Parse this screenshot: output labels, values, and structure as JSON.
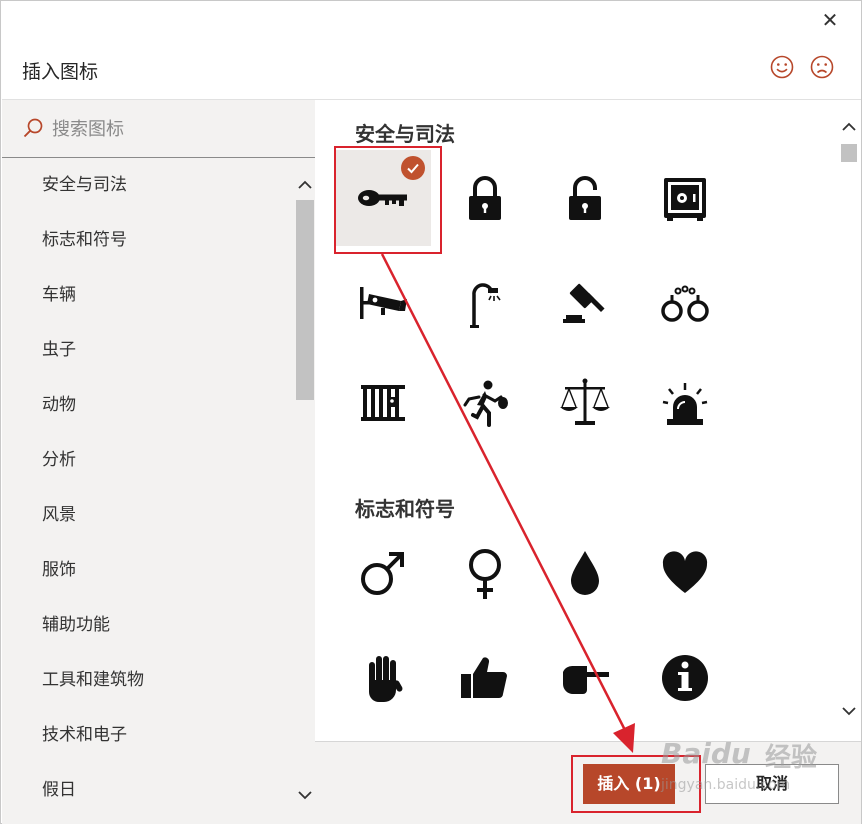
{
  "dialog": {
    "title": "插入图标",
    "close_glyph": "✕"
  },
  "feedback": {
    "happy_icon": "smile-icon",
    "sad_icon": "frown-icon"
  },
  "search": {
    "placeholder": "搜索图标"
  },
  "categories": [
    "安全与司法",
    "标志和符号",
    "车辆",
    "虫子",
    "动物",
    "分析",
    "风景",
    "服饰",
    "辅助功能",
    "工具和建筑物",
    "技术和电子",
    "假日"
  ],
  "sections": [
    {
      "title": "安全与司法",
      "icons": [
        "key-icon",
        "lock-icon",
        "unlock-icon",
        "safe-icon",
        "security-camera-icon",
        "street-light-icon",
        "gavel-icon",
        "handcuffs-icon",
        "jail-icon",
        "thief-icon",
        "scales-of-justice-icon",
        "siren-icon"
      ]
    },
    {
      "title": "标志和符号",
      "icons": [
        "male-symbol-icon",
        "female-symbol-icon",
        "drop-icon",
        "heart-icon",
        "hand-stop-icon",
        "thumbs-up-icon",
        "point-right-icon",
        "info-icon"
      ]
    }
  ],
  "selected_count_note": "1 selected",
  "buttons": {
    "insert": "插入 (1)",
    "cancel": "取消"
  },
  "colors": {
    "accent": "#b7472a",
    "annotation": "#d9232d",
    "panel_bg": "#f3f2f1"
  },
  "watermark": {
    "brand": "Baidu",
    "cn": "经验",
    "url": "jingyan.baidu.com"
  }
}
